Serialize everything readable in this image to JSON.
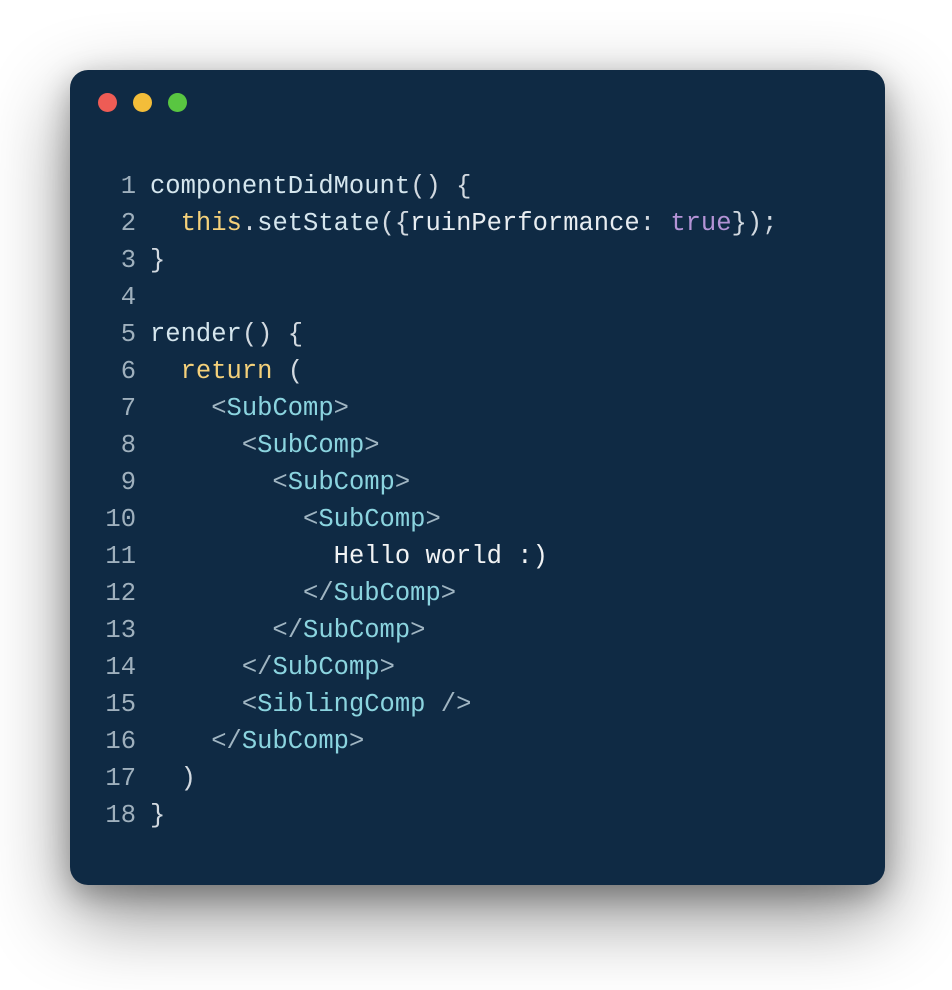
{
  "window": {
    "traffic_lights": {
      "red": "#ee5c55",
      "yellow": "#f3bd39",
      "green": "#59c641"
    },
    "background": "#0f2a44"
  },
  "code": {
    "line_count": 18,
    "gutter": [
      "1",
      "2",
      "3",
      "4",
      "5",
      "6",
      "7",
      "8",
      "9",
      "10",
      "11",
      "12",
      "13",
      "14",
      "15",
      "16",
      "17",
      "18"
    ],
    "lines": [
      [
        {
          "cls": "tok-method",
          "t": "componentDidMount"
        },
        {
          "cls": "tok-punct",
          "t": "() {"
        }
      ],
      [
        {
          "cls": "tok-default",
          "t": "  "
        },
        {
          "cls": "tok-keythis",
          "t": "this"
        },
        {
          "cls": "tok-punct",
          "t": "."
        },
        {
          "cls": "tok-method",
          "t": "setState"
        },
        {
          "cls": "tok-punct",
          "t": "({"
        },
        {
          "cls": "tok-prop",
          "t": "ruinPerformance"
        },
        {
          "cls": "tok-punct",
          "t": ": "
        },
        {
          "cls": "tok-true",
          "t": "true"
        },
        {
          "cls": "tok-punct",
          "t": "});"
        }
      ],
      [
        {
          "cls": "tok-punct",
          "t": "}"
        }
      ],
      [
        {
          "cls": "tok-default",
          "t": ""
        }
      ],
      [
        {
          "cls": "tok-method",
          "t": "render"
        },
        {
          "cls": "tok-punct",
          "t": "() {"
        }
      ],
      [
        {
          "cls": "tok-default",
          "t": "  "
        },
        {
          "cls": "tok-return",
          "t": "return"
        },
        {
          "cls": "tok-punct",
          "t": " ("
        }
      ],
      [
        {
          "cls": "tok-default",
          "t": "    "
        },
        {
          "cls": "tok-angle",
          "t": "<"
        },
        {
          "cls": "tok-tagname",
          "t": "SubComp"
        },
        {
          "cls": "tok-angle",
          "t": ">"
        }
      ],
      [
        {
          "cls": "tok-default",
          "t": "      "
        },
        {
          "cls": "tok-angle",
          "t": "<"
        },
        {
          "cls": "tok-tagname",
          "t": "SubComp"
        },
        {
          "cls": "tok-angle",
          "t": ">"
        }
      ],
      [
        {
          "cls": "tok-default",
          "t": "        "
        },
        {
          "cls": "tok-angle",
          "t": "<"
        },
        {
          "cls": "tok-tagname",
          "t": "SubComp"
        },
        {
          "cls": "tok-angle",
          "t": ">"
        }
      ],
      [
        {
          "cls": "tok-default",
          "t": "          "
        },
        {
          "cls": "tok-angle",
          "t": "<"
        },
        {
          "cls": "tok-tagname",
          "t": "SubComp"
        },
        {
          "cls": "tok-angle",
          "t": ">"
        }
      ],
      [
        {
          "cls": "tok-default",
          "t": "            "
        },
        {
          "cls": "tok-text",
          "t": "Hello world :)"
        }
      ],
      [
        {
          "cls": "tok-default",
          "t": "          "
        },
        {
          "cls": "tok-angle",
          "t": "</"
        },
        {
          "cls": "tok-tagname",
          "t": "SubComp"
        },
        {
          "cls": "tok-angle",
          "t": ">"
        }
      ],
      [
        {
          "cls": "tok-default",
          "t": "        "
        },
        {
          "cls": "tok-angle",
          "t": "</"
        },
        {
          "cls": "tok-tagname",
          "t": "SubComp"
        },
        {
          "cls": "tok-angle",
          "t": ">"
        }
      ],
      [
        {
          "cls": "tok-default",
          "t": "      "
        },
        {
          "cls": "tok-angle",
          "t": "</"
        },
        {
          "cls": "tok-tagname",
          "t": "SubComp"
        },
        {
          "cls": "tok-angle",
          "t": ">"
        }
      ],
      [
        {
          "cls": "tok-default",
          "t": "      "
        },
        {
          "cls": "tok-angle",
          "t": "<"
        },
        {
          "cls": "tok-tagname",
          "t": "SiblingComp"
        },
        {
          "cls": "tok-angle",
          "t": " />"
        }
      ],
      [
        {
          "cls": "tok-default",
          "t": "    "
        },
        {
          "cls": "tok-angle",
          "t": "</"
        },
        {
          "cls": "tok-tagname",
          "t": "SubComp"
        },
        {
          "cls": "tok-angle",
          "t": ">"
        }
      ],
      [
        {
          "cls": "tok-default",
          "t": "  "
        },
        {
          "cls": "tok-punct",
          "t": ")"
        }
      ],
      [
        {
          "cls": "tok-punct",
          "t": "}"
        }
      ]
    ]
  }
}
